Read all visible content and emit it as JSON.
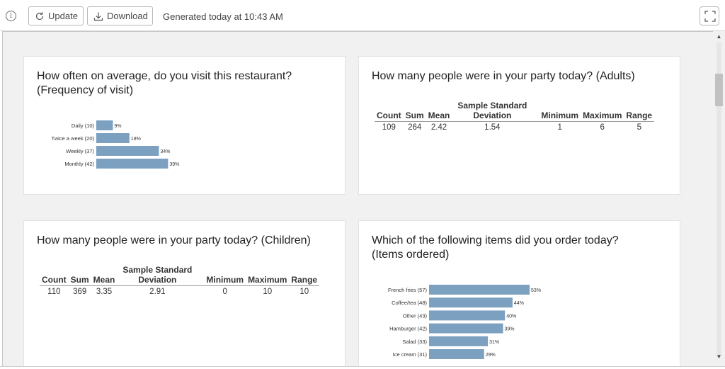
{
  "toolbar": {
    "update_label": "Update",
    "download_label": "Download",
    "generated_text": "Generated today at 10:43 AM"
  },
  "colors": {
    "bar": "#7ba0c0",
    "card_bg": "#ffffff",
    "page_bg": "#f1f1f1"
  },
  "cards": {
    "frequency": {
      "title_line1": "How often on average, do you visit this restaurant?",
      "title_line2": "(Frequency of visit)"
    },
    "adults": {
      "title": "How many people were in your party today? (Adults)",
      "headers": [
        "Count",
        "Sum",
        "Mean",
        "Sample Standard Deviation",
        "Minimum",
        "Maximum",
        "Range"
      ],
      "header_std_line1": "Sample Standard",
      "header_std_line2": "Deviation",
      "values": {
        "count": "109",
        "sum": "264",
        "mean": "2.42",
        "std": "1.54",
        "min": "1",
        "max": "6",
        "range": "5"
      }
    },
    "children": {
      "title": "How many people were in your party today? (Children)",
      "header_std_line1": "Sample Standard",
      "header_std_line2": "Deviation",
      "values": {
        "count": "110",
        "sum": "369",
        "mean": "3.35",
        "std": "2.91",
        "min": "0",
        "max": "10",
        "range": "10"
      }
    },
    "items": {
      "title_line1": "Which of the following items did you order today?",
      "title_line2": "(Items ordered)"
    }
  },
  "stat_headers": {
    "count": "Count",
    "sum": "Sum",
    "mean": "Mean",
    "min": "Minimum",
    "max": "Maximum",
    "range": "Range"
  },
  "chart_data": [
    {
      "type": "bar",
      "orientation": "horizontal",
      "categories": [
        "Daily (10)",
        "Twice a week (20)",
        "Weekly (37)",
        "Monthly (42)"
      ],
      "values": [
        9,
        18,
        34,
        39
      ],
      "value_labels": [
        "9%",
        "18%",
        "34%",
        "39%"
      ],
      "unit": "%"
    },
    {
      "type": "bar",
      "orientation": "horizontal",
      "categories": [
        "French fries (57)",
        "Coffee/tea (48)",
        "Other (43)",
        "Hamburger (42)",
        "Salad (33)",
        "Ice cream (31)"
      ],
      "values": [
        53,
        44,
        40,
        39,
        31,
        29
      ],
      "value_labels": [
        "53%",
        "44%",
        "40%",
        "39%",
        "31%",
        "29%"
      ],
      "unit": "%"
    }
  ]
}
